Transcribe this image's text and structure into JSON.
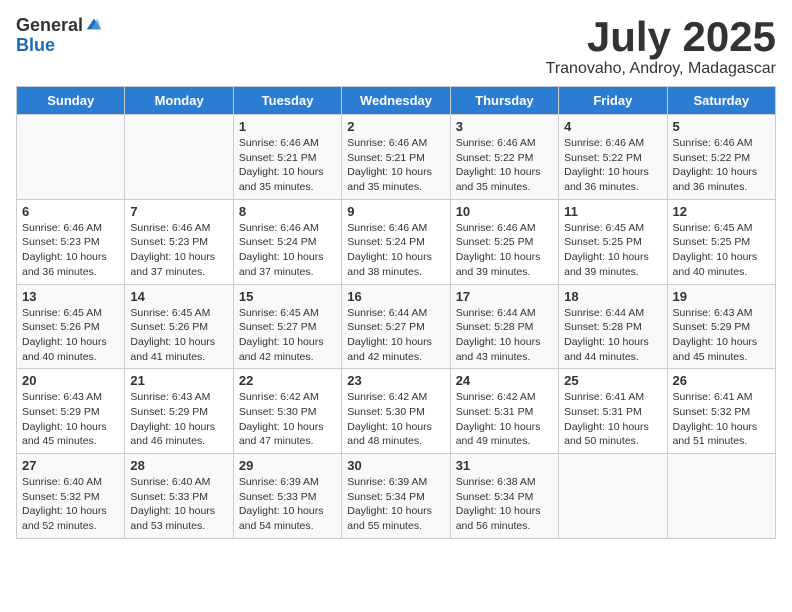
{
  "logo": {
    "general": "General",
    "blue": "Blue"
  },
  "title": "July 2025",
  "location": "Tranovaho, Androy, Madagascar",
  "days_of_week": [
    "Sunday",
    "Monday",
    "Tuesday",
    "Wednesday",
    "Thursday",
    "Friday",
    "Saturday"
  ],
  "weeks": [
    [
      {
        "day": "",
        "info": ""
      },
      {
        "day": "",
        "info": ""
      },
      {
        "day": "1",
        "info": "Sunrise: 6:46 AM\nSunset: 5:21 PM\nDaylight: 10 hours and 35 minutes."
      },
      {
        "day": "2",
        "info": "Sunrise: 6:46 AM\nSunset: 5:21 PM\nDaylight: 10 hours and 35 minutes."
      },
      {
        "day": "3",
        "info": "Sunrise: 6:46 AM\nSunset: 5:22 PM\nDaylight: 10 hours and 35 minutes."
      },
      {
        "day": "4",
        "info": "Sunrise: 6:46 AM\nSunset: 5:22 PM\nDaylight: 10 hours and 36 minutes."
      },
      {
        "day": "5",
        "info": "Sunrise: 6:46 AM\nSunset: 5:22 PM\nDaylight: 10 hours and 36 minutes."
      }
    ],
    [
      {
        "day": "6",
        "info": "Sunrise: 6:46 AM\nSunset: 5:23 PM\nDaylight: 10 hours and 36 minutes."
      },
      {
        "day": "7",
        "info": "Sunrise: 6:46 AM\nSunset: 5:23 PM\nDaylight: 10 hours and 37 minutes."
      },
      {
        "day": "8",
        "info": "Sunrise: 6:46 AM\nSunset: 5:24 PM\nDaylight: 10 hours and 37 minutes."
      },
      {
        "day": "9",
        "info": "Sunrise: 6:46 AM\nSunset: 5:24 PM\nDaylight: 10 hours and 38 minutes."
      },
      {
        "day": "10",
        "info": "Sunrise: 6:46 AM\nSunset: 5:25 PM\nDaylight: 10 hours and 39 minutes."
      },
      {
        "day": "11",
        "info": "Sunrise: 6:45 AM\nSunset: 5:25 PM\nDaylight: 10 hours and 39 minutes."
      },
      {
        "day": "12",
        "info": "Sunrise: 6:45 AM\nSunset: 5:25 PM\nDaylight: 10 hours and 40 minutes."
      }
    ],
    [
      {
        "day": "13",
        "info": "Sunrise: 6:45 AM\nSunset: 5:26 PM\nDaylight: 10 hours and 40 minutes."
      },
      {
        "day": "14",
        "info": "Sunrise: 6:45 AM\nSunset: 5:26 PM\nDaylight: 10 hours and 41 minutes."
      },
      {
        "day": "15",
        "info": "Sunrise: 6:45 AM\nSunset: 5:27 PM\nDaylight: 10 hours and 42 minutes."
      },
      {
        "day": "16",
        "info": "Sunrise: 6:44 AM\nSunset: 5:27 PM\nDaylight: 10 hours and 42 minutes."
      },
      {
        "day": "17",
        "info": "Sunrise: 6:44 AM\nSunset: 5:28 PM\nDaylight: 10 hours and 43 minutes."
      },
      {
        "day": "18",
        "info": "Sunrise: 6:44 AM\nSunset: 5:28 PM\nDaylight: 10 hours and 44 minutes."
      },
      {
        "day": "19",
        "info": "Sunrise: 6:43 AM\nSunset: 5:29 PM\nDaylight: 10 hours and 45 minutes."
      }
    ],
    [
      {
        "day": "20",
        "info": "Sunrise: 6:43 AM\nSunset: 5:29 PM\nDaylight: 10 hours and 45 minutes."
      },
      {
        "day": "21",
        "info": "Sunrise: 6:43 AM\nSunset: 5:29 PM\nDaylight: 10 hours and 46 minutes."
      },
      {
        "day": "22",
        "info": "Sunrise: 6:42 AM\nSunset: 5:30 PM\nDaylight: 10 hours and 47 minutes."
      },
      {
        "day": "23",
        "info": "Sunrise: 6:42 AM\nSunset: 5:30 PM\nDaylight: 10 hours and 48 minutes."
      },
      {
        "day": "24",
        "info": "Sunrise: 6:42 AM\nSunset: 5:31 PM\nDaylight: 10 hours and 49 minutes."
      },
      {
        "day": "25",
        "info": "Sunrise: 6:41 AM\nSunset: 5:31 PM\nDaylight: 10 hours and 50 minutes."
      },
      {
        "day": "26",
        "info": "Sunrise: 6:41 AM\nSunset: 5:32 PM\nDaylight: 10 hours and 51 minutes."
      }
    ],
    [
      {
        "day": "27",
        "info": "Sunrise: 6:40 AM\nSunset: 5:32 PM\nDaylight: 10 hours and 52 minutes."
      },
      {
        "day": "28",
        "info": "Sunrise: 6:40 AM\nSunset: 5:33 PM\nDaylight: 10 hours and 53 minutes."
      },
      {
        "day": "29",
        "info": "Sunrise: 6:39 AM\nSunset: 5:33 PM\nDaylight: 10 hours and 54 minutes."
      },
      {
        "day": "30",
        "info": "Sunrise: 6:39 AM\nSunset: 5:34 PM\nDaylight: 10 hours and 55 minutes."
      },
      {
        "day": "31",
        "info": "Sunrise: 6:38 AM\nSunset: 5:34 PM\nDaylight: 10 hours and 56 minutes."
      },
      {
        "day": "",
        "info": ""
      },
      {
        "day": "",
        "info": ""
      }
    ]
  ]
}
